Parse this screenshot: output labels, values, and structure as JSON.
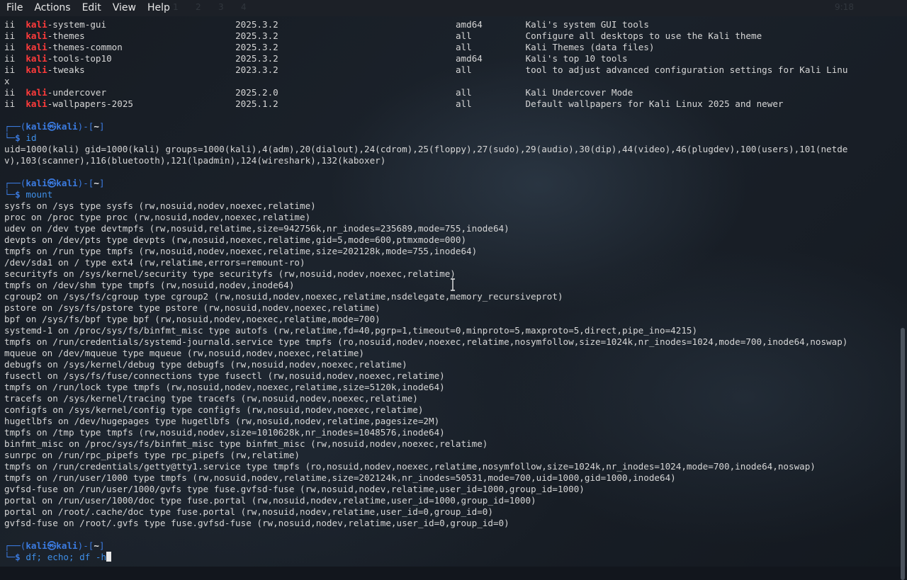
{
  "menubar": {
    "items": [
      "File",
      "Actions",
      "Edit",
      "View",
      "Help"
    ],
    "workspaces": [
      "1",
      "2",
      "3",
      "4"
    ],
    "clock": "9:18"
  },
  "terminal": {
    "packages": [
      {
        "status": "ii",
        "hl": "kali",
        "rest": "-system-gui",
        "version": "2025.3.2",
        "arch": "amd64",
        "desc": "Kali's system GUI tools"
      },
      {
        "status": "ii",
        "hl": "kali",
        "rest": "-themes",
        "version": "2025.3.2",
        "arch": "all",
        "desc": "Configure all desktops to use the Kali theme"
      },
      {
        "status": "ii",
        "hl": "kali",
        "rest": "-themes-common",
        "version": "2025.3.2",
        "arch": "all",
        "desc": "Kali Themes (data files)"
      },
      {
        "status": "ii",
        "hl": "kali",
        "rest": "-tools-top10",
        "version": "2025.3.2",
        "arch": "amd64",
        "desc": "Kali's top 10 tools"
      },
      {
        "status": "ii",
        "hl": "kali",
        "rest": "-tweaks",
        "version": "2023.3.2",
        "arch": "all",
        "desc": "tool to adjust advanced configuration settings for Kali Linu"
      },
      {
        "wrap": "x"
      },
      {
        "status": "ii",
        "hl": "kali",
        "rest": "-undercover",
        "version": "2025.2.0",
        "arch": "all",
        "desc": "Kali Undercover Mode"
      },
      {
        "status": "ii",
        "hl": "kali",
        "rest": "-wallpapers-2025",
        "version": "2025.1.2",
        "arch": "all",
        "desc": "Default wallpapers for Kali Linux 2025 and newer"
      }
    ],
    "prompt": {
      "user": "kali",
      "at": "㉿",
      "host": "kali",
      "dir": "~"
    },
    "cmd_id": "id",
    "id_output": [
      "uid=1000(kali) gid=1000(kali) groups=1000(kali),4(adm),20(dialout),24(cdrom),25(floppy),27(sudo),29(audio),30(dip),44(video),46(plugdev),100(users),101(netde",
      "v),103(scanner),116(bluetooth),121(lpadmin),124(wireshark),132(kaboxer)"
    ],
    "cmd_mount": "mount",
    "mount_output": [
      "sysfs on /sys type sysfs (rw,nosuid,nodev,noexec,relatime)",
      "proc on /proc type proc (rw,nosuid,nodev,noexec,relatime)",
      "udev on /dev type devtmpfs (rw,nosuid,relatime,size=942756k,nr_inodes=235689,mode=755,inode64)",
      "devpts on /dev/pts type devpts (rw,nosuid,noexec,relatime,gid=5,mode=600,ptmxmode=000)",
      "tmpfs on /run type tmpfs (rw,nosuid,nodev,noexec,relatime,size=202128k,mode=755,inode64)",
      "/dev/sda1 on / type ext4 (rw,relatime,errors=remount-ro)",
      "securityfs on /sys/kernel/security type securityfs (rw,nosuid,nodev,noexec,relatime)",
      "tmpfs on /dev/shm type tmpfs (rw,nosuid,nodev,inode64)",
      "cgroup2 on /sys/fs/cgroup type cgroup2 (rw,nosuid,nodev,noexec,relatime,nsdelegate,memory_recursiveprot)",
      "pstore on /sys/fs/pstore type pstore (rw,nosuid,nodev,noexec,relatime)",
      "bpf on /sys/fs/bpf type bpf (rw,nosuid,nodev,noexec,relatime,mode=700)",
      "systemd-1 on /proc/sys/fs/binfmt_misc type autofs (rw,relatime,fd=40,pgrp=1,timeout=0,minproto=5,maxproto=5,direct,pipe_ino=4215)",
      "tmpfs on /run/credentials/systemd-journald.service type tmpfs (ro,nosuid,nodev,noexec,relatime,nosymfollow,size=1024k,nr_inodes=1024,mode=700,inode64,noswap)",
      "mqueue on /dev/mqueue type mqueue (rw,nosuid,nodev,noexec,relatime)",
      "debugfs on /sys/kernel/debug type debugfs (rw,nosuid,nodev,noexec,relatime)",
      "fusectl on /sys/fs/fuse/connections type fusectl (rw,nosuid,nodev,noexec,relatime)",
      "tmpfs on /run/lock type tmpfs (rw,nosuid,nodev,noexec,relatime,size=5120k,inode64)",
      "tracefs on /sys/kernel/tracing type tracefs (rw,nosuid,nodev,noexec,relatime)",
      "configfs on /sys/kernel/config type configfs (rw,nosuid,nodev,noexec,relatime)",
      "hugetlbfs on /dev/hugepages type hugetlbfs (rw,nosuid,nodev,relatime,pagesize=2M)",
      "tmpfs on /tmp type tmpfs (rw,nosuid,nodev,size=1010628k,nr_inodes=1048576,inode64)",
      "binfmt_misc on /proc/sys/fs/binfmt_misc type binfmt_misc (rw,nosuid,nodev,noexec,relatime)",
      "sunrpc on /run/rpc_pipefs type rpc_pipefs (rw,relatime)",
      "tmpfs on /run/credentials/getty@tty1.service type tmpfs (ro,nosuid,nodev,noexec,relatime,nosymfollow,size=1024k,nr_inodes=1024,mode=700,inode64,noswap)",
      "tmpfs on /run/user/1000 type tmpfs (rw,nosuid,nodev,relatime,size=202124k,nr_inodes=50531,mode=700,uid=1000,gid=1000,inode64)",
      "gvfsd-fuse on /run/user/1000/gvfs type fuse.gvfsd-fuse (rw,nosuid,nodev,relatime,user_id=1000,group_id=1000)",
      "portal on /run/user/1000/doc type fuse.portal (rw,nosuid,nodev,relatime,user_id=1000,group_id=1000)",
      "portal on /root/.cache/doc type fuse.portal (rw,nosuid,nodev,relatime,user_id=0,group_id=0)",
      "gvfsd-fuse on /root/.gvfs type fuse.gvfsd-fuse (rw,nosuid,nodev,relatime,user_id=0,group_id=0)"
    ],
    "current_input": "df; echo; df -h",
    "colors": {
      "highlight": "#ff3b3b",
      "prompt": "#3b7be0",
      "command": "#3f8fe8",
      "text": "#d6d6d6"
    }
  }
}
